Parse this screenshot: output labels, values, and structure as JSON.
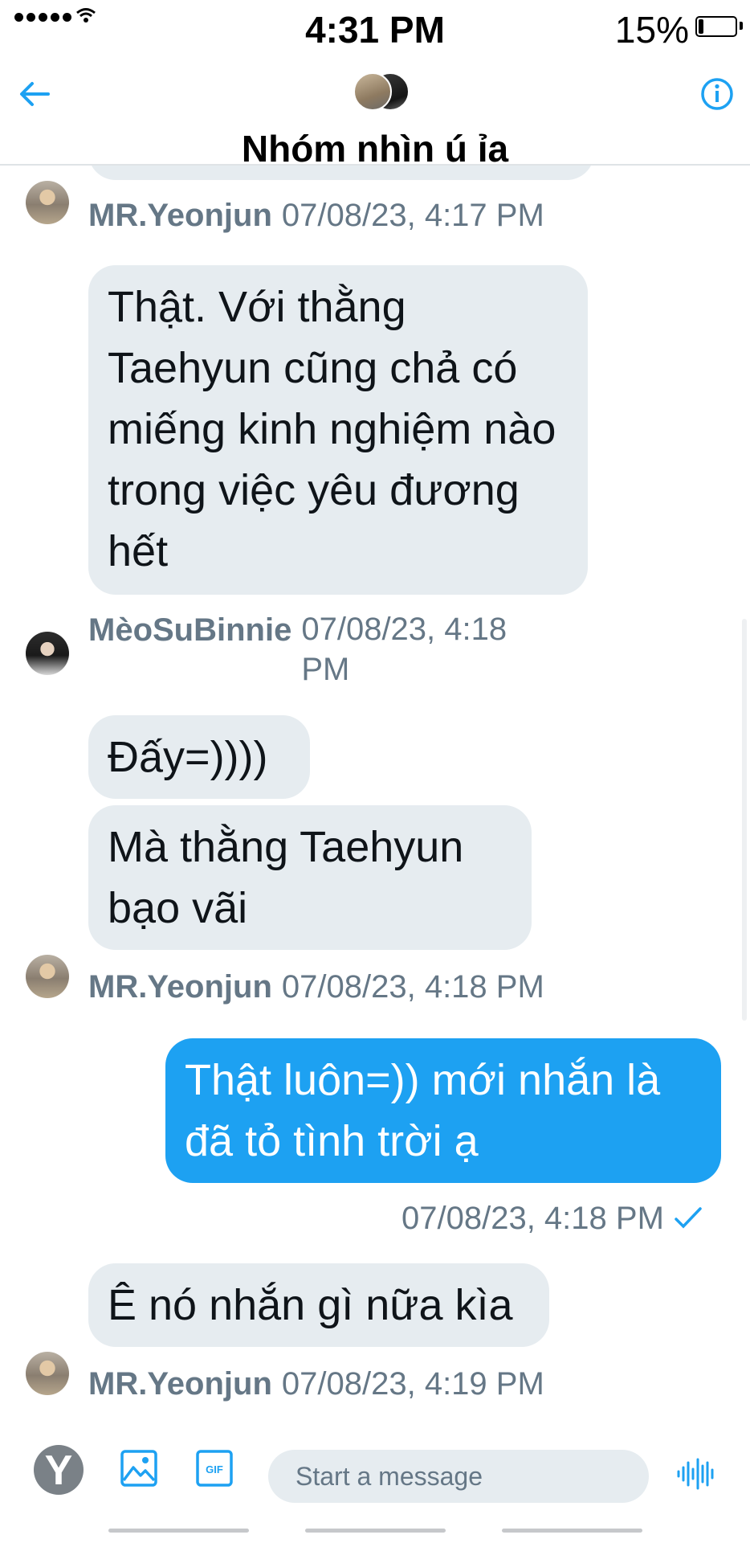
{
  "status_bar": {
    "time": "4:31 PM",
    "battery_percent": "15%",
    "battery_level": 0.15
  },
  "header": {
    "group_name": "Nhóm nhìn ú ỉa",
    "back_icon": "arrow-left-icon",
    "info_icon": "info-icon"
  },
  "messages": [
    {
      "text": "Thật. Với thằng Taehyun cũng chả có miếng kinh nghiệm nào trong việc yêu đương hết",
      "sender": "MR.Yeonjun",
      "timestamp": "07/08/23, 4:17 PM"
    },
    {
      "sender": "MèoSuBinnie",
      "timestamp": "07/08/23, 4:18 PM"
    },
    {
      "text": "Đấy=))))"
    },
    {
      "text": "Mà thằng Taehyun bạo vãi",
      "sender": "MR.Yeonjun",
      "timestamp": "07/08/23, 4:18 PM"
    },
    {
      "text": "Thật luôn=)) mới nhắn là đã tỏ tình trời ạ",
      "timestamp": "07/08/23, 4:18 PM",
      "outgoing": true
    },
    {
      "text": "Ê nó nhắn gì nữa kìa",
      "sender": "MR.Yeonjun",
      "timestamp": "07/08/23, 4:19 PM"
    }
  ],
  "meta_labels": {
    "m1_name": "MR.Yeonjun",
    "m1_ts": "07/08/23, 4:17 PM",
    "m2_name": "MèoSuBinnie",
    "m2_ts": "07/08/23, 4:18 PM",
    "m3_name": "MR.Yeonjun",
    "m3_ts": "07/08/23, 4:18 PM",
    "m4_ts": "07/08/23, 4:18 PM",
    "m5_name": "MR.Yeonjun",
    "m5_ts": "07/08/23, 4:19 PM"
  },
  "bubbles": {
    "b1": "Thật. Với thằng Taehyun cũng chả có miếng kinh nghiệm nào trong việc yêu đương hết",
    "b2": "Đấy=))))",
    "b3": "Mà thằng Taehyun bạo vãi",
    "b4": "Thật luôn=)) mới nhắn là đã tỏ tình trời ạ",
    "b5": "Ê nó nhắn gì nữa kìa"
  },
  "composer": {
    "placeholder": "Start a message",
    "gif_label": "GIF",
    "logo_letter": "Y"
  },
  "colors": {
    "accent": "#1da1f2",
    "incoming_bubble": "#e6ecf0",
    "meta_text": "#657786"
  }
}
